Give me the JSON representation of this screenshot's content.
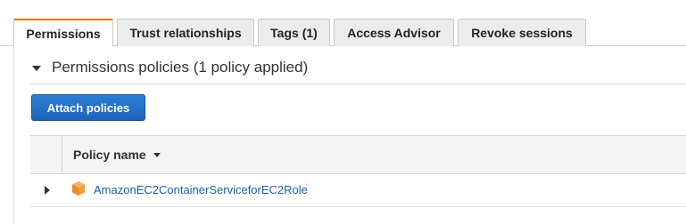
{
  "tabs": [
    {
      "label": "Permissions",
      "active": true
    },
    {
      "label": "Trust relationships",
      "active": false
    },
    {
      "label": "Tags (1)",
      "active": false
    },
    {
      "label": "Access Advisor",
      "active": false
    },
    {
      "label": "Revoke sessions",
      "active": false
    }
  ],
  "permissions": {
    "section_title": "Permissions policies (1 policy applied)",
    "attach_button": "Attach policies",
    "table": {
      "columns": [
        "Policy name"
      ],
      "rows": [
        {
          "name": "AmazonEC2ContainerServiceforEC2Role",
          "icon": "aws-managed-policy-icon"
        }
      ]
    }
  },
  "colors": {
    "active_tab_accent": "#ec7211",
    "primary_button": "#1d63bb",
    "link": "#1a5faa",
    "policy_icon": "#f29d38"
  }
}
